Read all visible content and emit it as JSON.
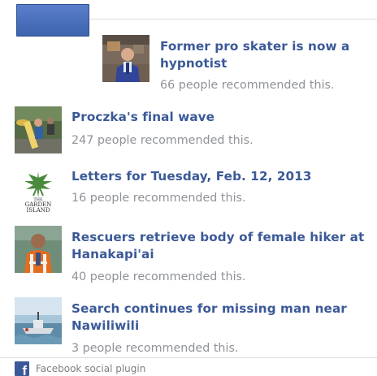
{
  "recommendations": [
    {
      "title": "Former pro skater is now a hypnotist",
      "count": "66",
      "suffix": " people recommended this.",
      "thumb_icon": "man-in-office-photo"
    },
    {
      "title": "Proczka's final wave",
      "count": "247",
      "suffix": " people recommended this.",
      "thumb_icon": "surfboard-crowd-photo"
    },
    {
      "title": "Letters for Tuesday, Feb. 12, 2013",
      "count": "16",
      "suffix": " people recommended this.",
      "thumb_icon": "garden-island-logo",
      "thumb_text_line1": "THE",
      "thumb_text_line2": "GARDEN",
      "thumb_text_line3": "ISLAND"
    },
    {
      "title": "Rescuers retrieve body of female hiker at Hanakapi'ai",
      "count": "40",
      "suffix": " people recommended this.",
      "thumb_icon": "rescuer-safety-vest-photo"
    },
    {
      "title": "Search continues for missing man near Nawiliwili",
      "count": "3",
      "suffix": " people recommended this.",
      "thumb_icon": "boat-harbor-photo"
    }
  ],
  "footer": {
    "label": "Facebook social plugin",
    "icon": "facebook-icon",
    "icon_glyph": "f"
  },
  "colors": {
    "link": "#3b5998",
    "muted": "#8f9297",
    "divider": "#d9dce3"
  }
}
